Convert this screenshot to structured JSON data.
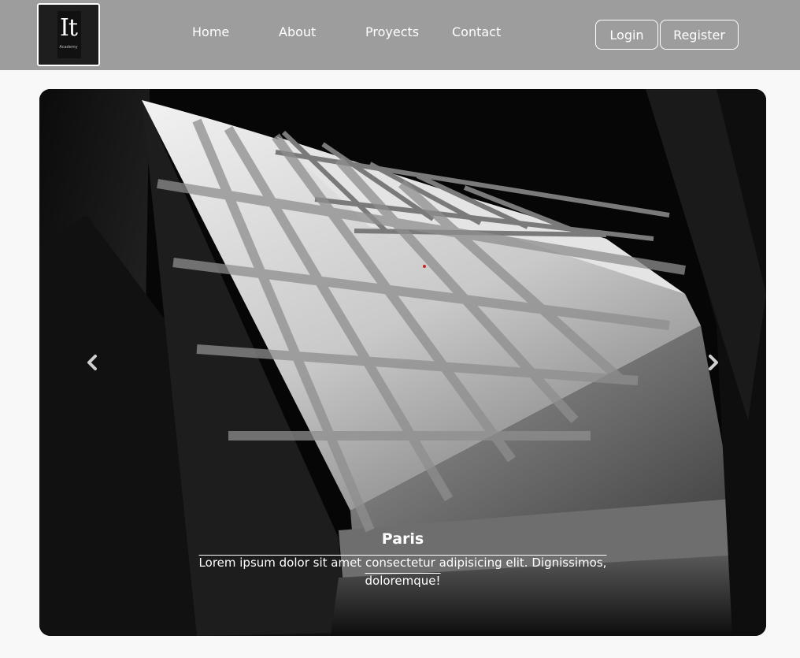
{
  "navbar": {
    "logo": {
      "main": "It",
      "sub": "Academy"
    },
    "links": [
      "Home",
      "About",
      "Proyects",
      "Contact"
    ],
    "login_label": "Login",
    "register_label": "Register"
  },
  "carousel": {
    "prev_icon": "chevron-left-icon",
    "next_icon": "chevron-right-icon",
    "caption": {
      "title": "Paris",
      "text": "Lorem ipsum dolor sit amet consectetur adipisicing elit. Dignissimos, doloremque!"
    }
  },
  "colors": {
    "navbar_bg": "#9d9d9d",
    "page_bg": "#f8f8f8",
    "carousel_bg": "#050505"
  }
}
